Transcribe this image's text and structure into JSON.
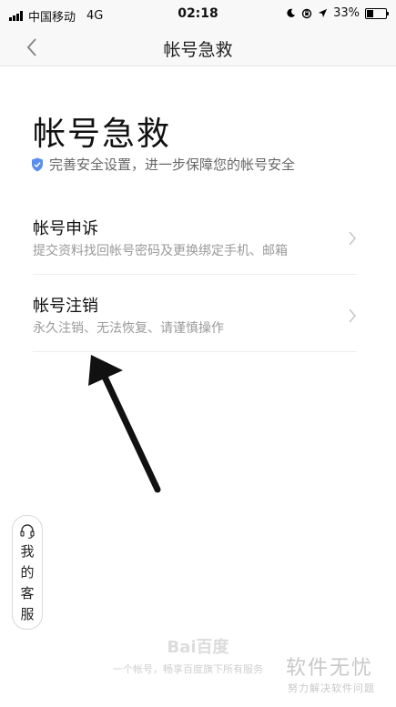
{
  "status_bar": {
    "carrier": "中国移动",
    "network": "4G",
    "time": "02:18",
    "battery_percent": "33%",
    "battery_level": 0.33
  },
  "nav": {
    "title": "帐号急救"
  },
  "main": {
    "heading": "帐号急救",
    "security_text": "完善安全设置，进一步保障您的帐号安全",
    "options": [
      {
        "title": "帐号申诉",
        "description": "提交资料找回帐号密码及更换绑定手机、邮箱"
      },
      {
        "title": "帐号注销",
        "description": "永久注销、无法恢复、请谨慎操作"
      }
    ]
  },
  "service_button": {
    "chars": [
      "我",
      "的",
      "客",
      "服"
    ]
  },
  "footer": {
    "logo_text": "Bai百度",
    "text": "一个帐号，畅享百度旗下所有服务"
  },
  "watermark": {
    "main": "软件无忧",
    "sub": "努力解决软件问题"
  },
  "colors": {
    "shield": "#5b8def",
    "annotation_arrow": "#111111"
  }
}
